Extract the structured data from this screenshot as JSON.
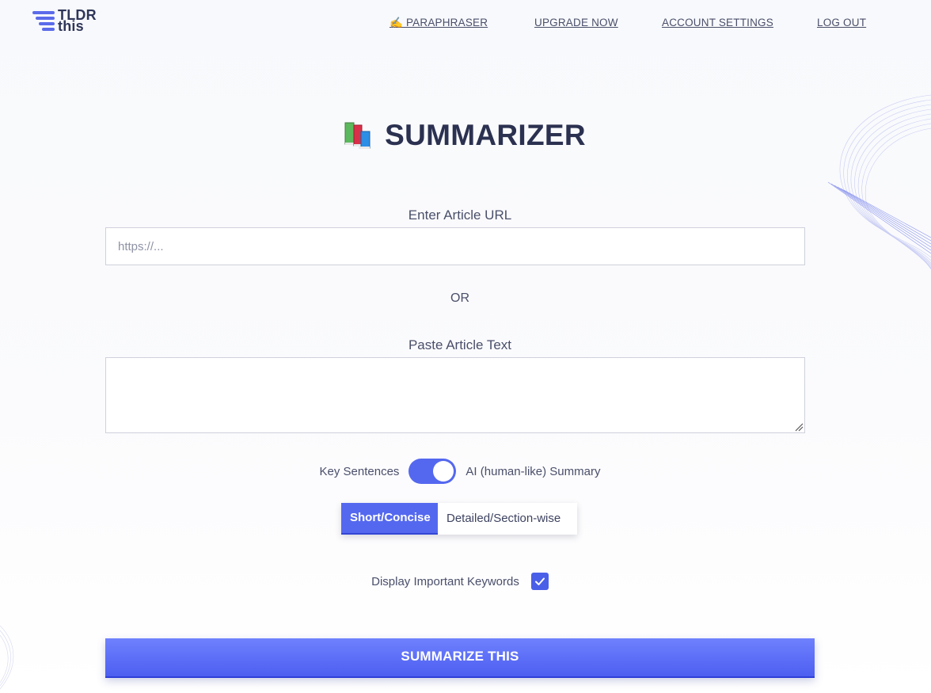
{
  "header": {
    "logo_line1": "TLDR",
    "logo_line2": "this",
    "nav": [
      {
        "label": "✍️ PARAPHRASER"
      },
      {
        "label": "UPGRADE NOW"
      },
      {
        "label": "ACCOUNT SETTINGS"
      },
      {
        "label": "LOG OUT"
      }
    ]
  },
  "main": {
    "title": "SUMMARIZER",
    "url_label": "Enter Article URL",
    "url_placeholder": "https://...",
    "url_value": "",
    "or_text": "OR",
    "text_label": "Paste Article Text",
    "text_value": "",
    "toggle": {
      "left_label": "Key Sentences",
      "right_label": "AI (human-like) Summary",
      "state": "AI (human-like) Summary"
    },
    "length_options": [
      {
        "label": "Short/Concise",
        "selected": true
      },
      {
        "label": "Detailed/Section-wise",
        "selected": false
      }
    ],
    "keywords_label": "Display Important Keywords",
    "keywords_checked": true,
    "submit_label": "SUMMARIZE THIS"
  },
  "colors": {
    "accent": "#5468ef",
    "title": "#2b3150",
    "text": "#4a4f6a"
  }
}
